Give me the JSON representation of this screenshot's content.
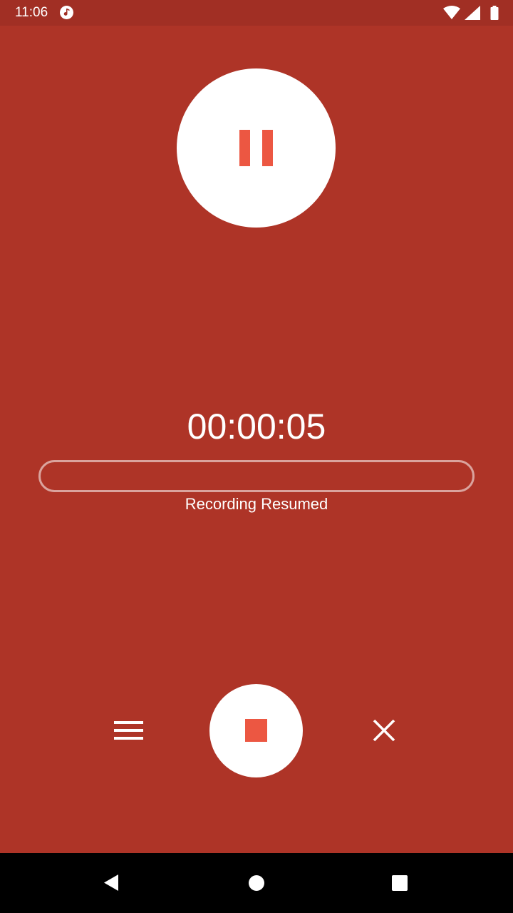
{
  "status_bar": {
    "time": "11:06",
    "icons": [
      "music-note-icon",
      "wifi-icon",
      "cell-signal-icon",
      "battery-icon"
    ]
  },
  "recorder": {
    "timer": "00:00:05",
    "status_message": "Recording Resumed",
    "primary_control": "pause-icon",
    "secondary_controls": [
      "menu-icon",
      "stop-icon",
      "close-icon"
    ]
  },
  "navigation": {
    "icons": [
      "back-icon",
      "home-icon",
      "recents-icon"
    ]
  },
  "colors": {
    "background": "#AE3427",
    "status_bar": "#A12F24",
    "accent": "#EC5742",
    "button_fill": "#FFFFFF"
  }
}
